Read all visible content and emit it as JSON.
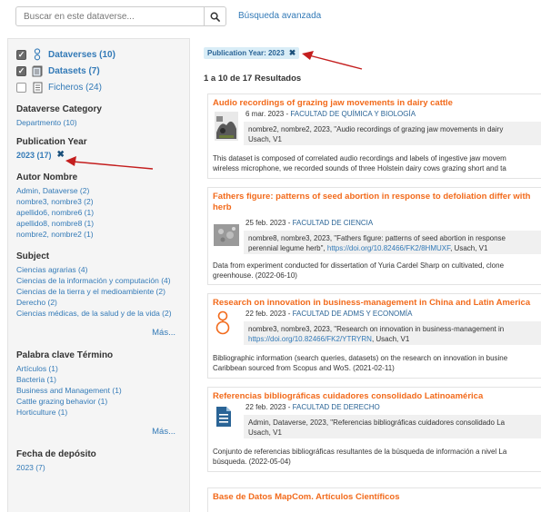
{
  "search": {
    "placeholder": "Buscar en este dataverse...",
    "advanced_label": "Búsqueda avanzada"
  },
  "sidebar": {
    "types": [
      {
        "label": "Dataverses (10)",
        "checked": true,
        "icon": "dataverse-icon"
      },
      {
        "label": "Datasets (7)",
        "checked": true,
        "icon": "dataset-icon"
      },
      {
        "label": "Ficheros (24)",
        "checked": false,
        "icon": "file-icon"
      }
    ],
    "facets": {
      "category": {
        "title": "Dataverse Category",
        "items": [
          "Departmento (10)"
        ]
      },
      "pub_year": {
        "title": "Publication Year",
        "selected": "2023 (17)",
        "remove_symbol": "✖"
      },
      "author": {
        "title": "Autor Nombre",
        "items": [
          "Admin, Dataverse (2)",
          "nombre3, nombre3 (2)",
          "apellido6, nombre6 (1)",
          "apellido8, nombre8 (1)",
          "nombre2, nombre2 (1)"
        ]
      },
      "subject": {
        "title": "Subject",
        "items": [
          "Ciencias agrarias (4)",
          "Ciencias de la información y computación (4)",
          "Ciencias de la tierra y el medioambiente (2)",
          "Derecho (2)",
          "Ciencias médicas, de la salud y de la vida (2)"
        ],
        "more": "Más..."
      },
      "keyword": {
        "title": "Palabra clave Término",
        "items": [
          "Artículos (1)",
          "Bacteria (1)",
          "Business and Management (1)",
          "Cattle grazing behavior (1)",
          "Horticulture (1)"
        ],
        "more": "Más..."
      },
      "deposit": {
        "title": "Fecha de depósito",
        "items": [
          "2023 (7)"
        ]
      }
    }
  },
  "main": {
    "filter_badge": "Publication Year: 2023",
    "filter_remove": "✖",
    "results_count": "1 a 10 de 17 Resultados",
    "cards": [
      {
        "title": "Audio recordings of grazing jaw movements in dairy cattle",
        "date": "6 mar. 2023 - ",
        "affiliation": "FACULTAD DE QUÍMICA Y BIOLOGÍA",
        "citation_1": "nombre2, nombre2, 2023, \"Audio recordings of grazing jaw movements in dairy",
        "citation_2": "Usach, V1",
        "doi": "",
        "desc_1": "This dataset is composed of correlated audio recordings and labels of ingestive jaw movem",
        "desc_2": "wireless microphone, we recorded sounds of three Holstein dairy cows grazing short and ta"
      },
      {
        "title": "Fathers figure: patterns of seed abortion in response to defoliation differ with",
        "title_2": "herb",
        "date": "25 feb. 2023 - ",
        "affiliation": "FACULTAD DE CIENCIA",
        "citation_1": "nombre8, nombre3, 2023, \"Fathers figure: patterns of seed abortion in response",
        "citation_2": "perennial legume herb\", ",
        "doi": "https://doi.org/10.82466/FK2/8HMUXF",
        "citation_3": ", Usach, V1",
        "desc_1": "Data from experiment conducted for dissertation of Yuria Cardel Sharp on cultivated, clone",
        "desc_2": "greenhouse. (2022-06-10)"
      },
      {
        "title": "Research on innovation in business-management in China and Latin America",
        "date": "22 feb. 2023 - ",
        "affiliation": "FACULTAD DE ADMS Y ECONOMÍA",
        "citation_1": "nombre3, nombre3, 2023, \"Research on innovation in business-management in",
        "doi": "https://doi.org/10.82466/FK2/YTRYRN",
        "citation_3": ", Usach, V1",
        "desc_1": "Bibliographic information (search queries, datasets) on the research on innovation in busine",
        "desc_2": "Caribbean sourced from Scopus and WoS. (2021-02-11)"
      },
      {
        "title": "Referencias bibliográficas cuidadores consolidado Latinoamérica",
        "date": "22 feb. 2023 - ",
        "affiliation": "FACULTAD DE DERECHO",
        "citation_1": "Admin, Dataverse, 2023, \"Referencias bibliográficas cuidadores consolidado La",
        "citation_2": "Usach, V1",
        "desc_1": "Conjunto de referencias bibliográficas resultantes de la búsqueda de información a nivel La",
        "desc_2": "búsqueda. (2022-05-04)"
      },
      {
        "title": "Base de Datos MapCom. Artículos Científicos"
      }
    ]
  },
  "colors": {
    "link": "#337ab7",
    "title_orange": "#f26a1b",
    "arrow_red": "#c41e1e",
    "badge_bg": "#d9edf7"
  }
}
